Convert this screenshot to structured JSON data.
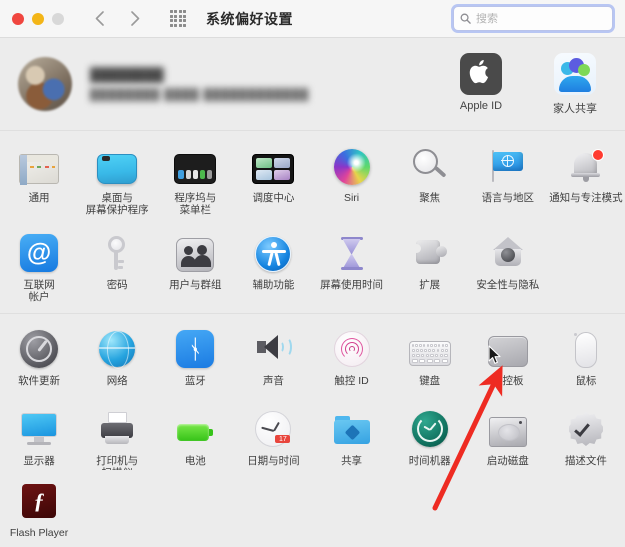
{
  "window": {
    "title": "系统偏好设置",
    "traffic_lights": [
      "close",
      "minimize",
      "zoom"
    ],
    "nav_back_icon": "chevron-left-icon",
    "nav_forward_icon": "chevron-right-icon",
    "grid_view_icon": "grid-view-icon"
  },
  "search": {
    "placeholder": "搜索",
    "value": "",
    "icon": "search-icon",
    "focus_ring_color": "#6c8cf0"
  },
  "account": {
    "name_redacted": "████████",
    "detail_redacted": "████████  ████  ████████████",
    "avatar_icon": "user-avatar",
    "shortcuts": [
      {
        "label": "Apple ID",
        "icon": "apple-logo-icon"
      },
      {
        "label": "家人共享",
        "icon": "family-sharing-icon"
      }
    ]
  },
  "sections": [
    {
      "id": "section-1",
      "items": [
        {
          "label": "通用",
          "icon": "general-icon"
        },
        {
          "label": "桌面与\n屏幕保护程序",
          "icon": "desktop-screensaver-icon"
        },
        {
          "label": "程序坞与\n菜单栏",
          "icon": "dock-menubar-icon"
        },
        {
          "label": "调度中心",
          "icon": "mission-control-icon"
        },
        {
          "label": "Siri",
          "icon": "siri-icon"
        },
        {
          "label": "聚焦",
          "icon": "spotlight-icon"
        },
        {
          "label": "语言与地区",
          "icon": "language-region-icon"
        },
        {
          "label": "通知与专注模式",
          "icon": "notifications-focus-icon"
        },
        {
          "label": "互联网\n帐户",
          "icon": "internet-accounts-icon"
        },
        {
          "label": "密码",
          "icon": "passwords-key-icon"
        },
        {
          "label": "用户与群组",
          "icon": "users-groups-icon"
        },
        {
          "label": "辅助功能",
          "icon": "accessibility-icon"
        },
        {
          "label": "屏幕使用时间",
          "icon": "screen-time-icon"
        },
        {
          "label": "扩展",
          "icon": "extensions-puzzle-icon"
        },
        {
          "label": "安全性与隐私",
          "icon": "security-privacy-icon"
        }
      ]
    },
    {
      "id": "section-2",
      "items": [
        {
          "label": "软件更新",
          "icon": "software-update-icon"
        },
        {
          "label": "网络",
          "icon": "network-globe-icon"
        },
        {
          "label": "蓝牙",
          "icon": "bluetooth-icon"
        },
        {
          "label": "声音",
          "icon": "sound-speaker-icon"
        },
        {
          "label": "触控 ID",
          "icon": "touch-id-icon"
        },
        {
          "label": "键盘",
          "icon": "keyboard-icon"
        },
        {
          "label": "触控板",
          "icon": "trackpad-icon"
        },
        {
          "label": "鼠标",
          "icon": "mouse-icon"
        },
        {
          "label": "显示器",
          "icon": "displays-icon"
        },
        {
          "label": "打印机与\n扫描仪",
          "icon": "printers-scanners-icon"
        },
        {
          "label": "电池",
          "icon": "battery-icon"
        },
        {
          "label": "日期与时间",
          "icon": "date-time-icon",
          "badge": "17"
        },
        {
          "label": "共享",
          "icon": "sharing-folder-icon"
        },
        {
          "label": "时间机器",
          "icon": "time-machine-icon"
        },
        {
          "label": "启动磁盘",
          "icon": "startup-disk-icon"
        },
        {
          "label": "描述文件",
          "icon": "profiles-icon"
        }
      ]
    }
  ],
  "third_party": {
    "items": [
      {
        "label": "Flash Player",
        "icon": "flash-player-icon"
      }
    ]
  },
  "annotation": {
    "arrow_color": "#ee2b22",
    "target": "触控板",
    "cursor_icon": "mouse-pointer-icon"
  }
}
